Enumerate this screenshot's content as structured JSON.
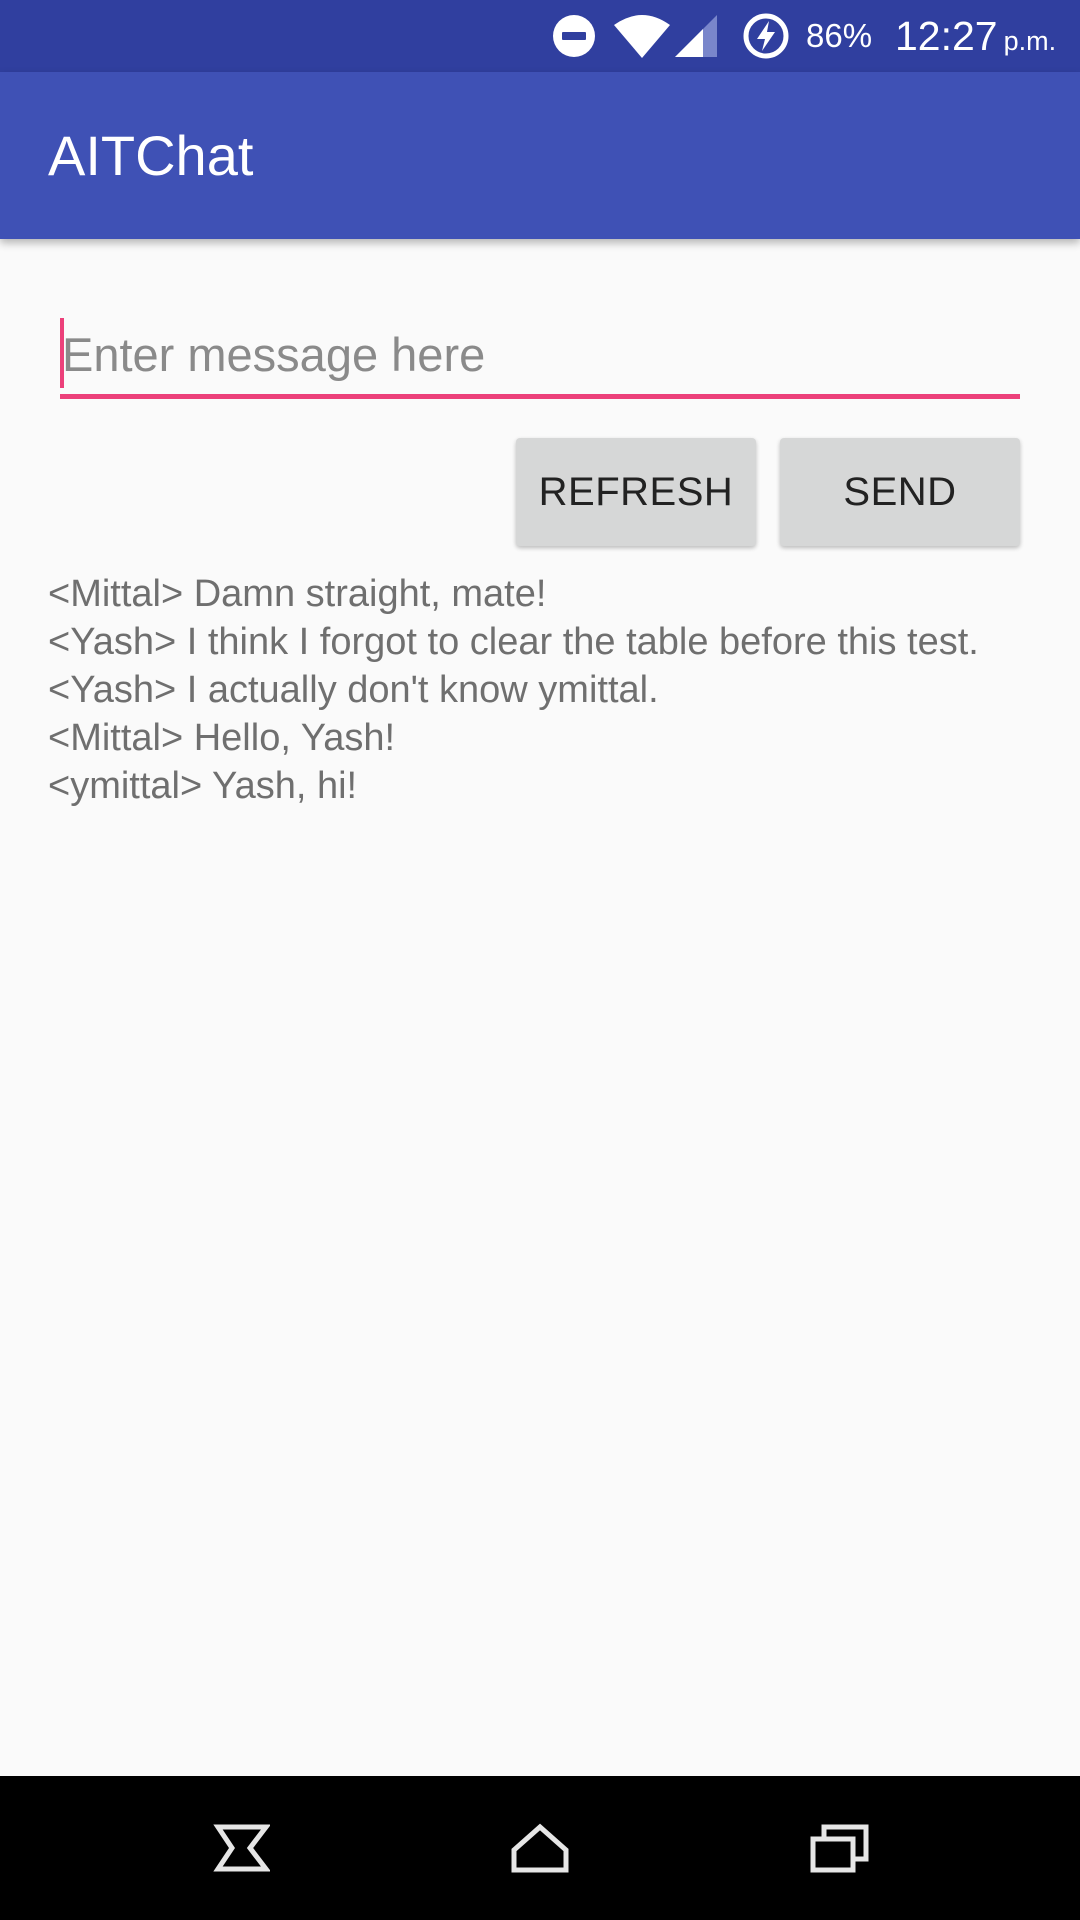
{
  "status_bar": {
    "battery_percent": "86%",
    "time": "12:27",
    "ampm": "p.m.",
    "icons": [
      "do-not-disturb-icon",
      "wifi-icon",
      "cell-signal-icon",
      "battery-charging-icon"
    ]
  },
  "app_bar": {
    "title": "AITChat"
  },
  "composer": {
    "placeholder": "Enter message here",
    "value": ""
  },
  "buttons": {
    "refresh_label": "REFRESH",
    "send_label": "SEND"
  },
  "messages": [
    "<Mittal> Damn straight, mate!",
    "<Yash> I think I forgot to clear the table before this test.",
    "<Yash> I actually don't know ymittal.",
    "<Mittal> Hello, Yash!",
    "<ymittal> Yash, hi!"
  ],
  "colors": {
    "status_bar": "#303f9f",
    "app_bar": "#3f51b5",
    "accent": "#ec407a",
    "button": "#d6d7d7",
    "background": "#fafafa"
  },
  "navigation": {
    "icons": [
      "back-icon",
      "home-icon",
      "recents-icon"
    ]
  }
}
